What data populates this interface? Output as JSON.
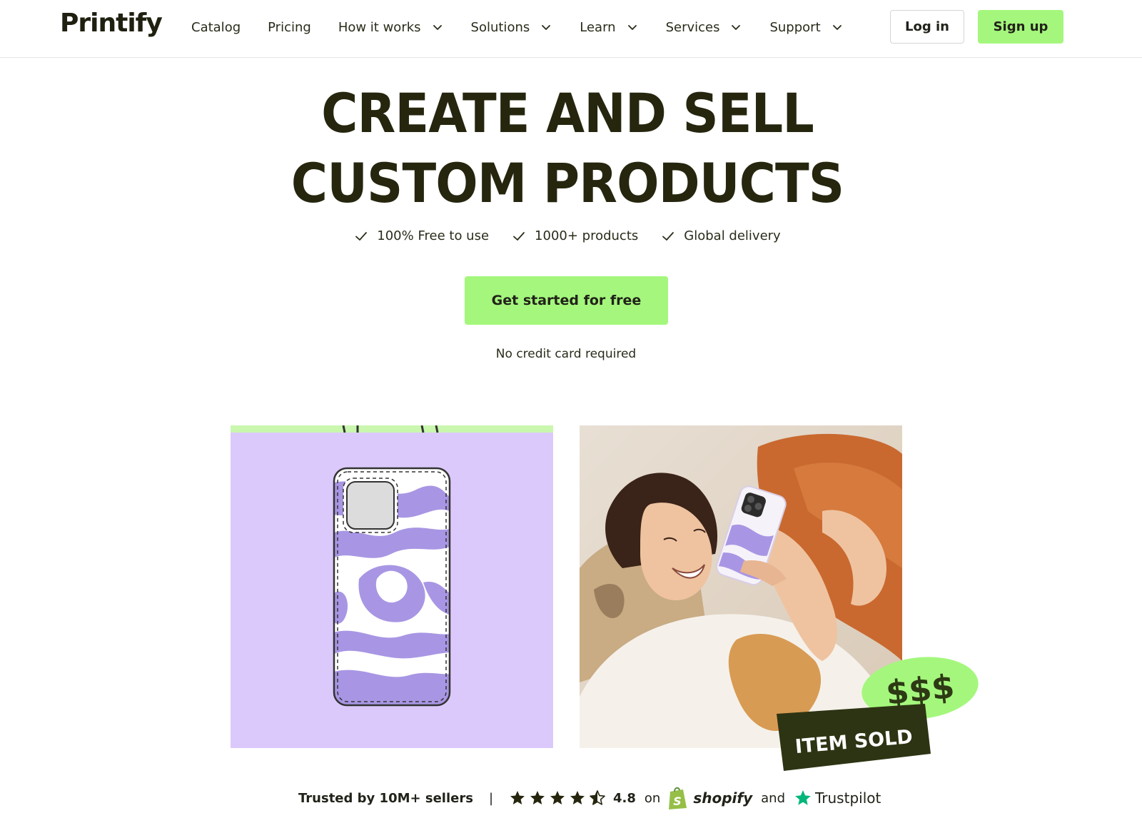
{
  "header": {
    "logo": "Printify",
    "nav": [
      {
        "label": "Catalog",
        "dropdown": false
      },
      {
        "label": "Pricing",
        "dropdown": false
      },
      {
        "label": "How it works",
        "dropdown": true
      },
      {
        "label": "Solutions",
        "dropdown": true
      },
      {
        "label": "Learn",
        "dropdown": true
      },
      {
        "label": "Services",
        "dropdown": true
      },
      {
        "label": "Support",
        "dropdown": true
      }
    ],
    "login_label": "Log in",
    "signup_label": "Sign up"
  },
  "hero": {
    "title_line1": "CREATE AND SELL",
    "title_line2": "CUSTOM PRODUCTS",
    "benefits": [
      "100% Free to use",
      "1000+ products",
      "Global delivery"
    ],
    "cta_label": "Get started for free",
    "note": "No credit card required"
  },
  "badges": {
    "money": "$$$",
    "sold": "ITEM SOLD"
  },
  "trust": {
    "sellers": "Trusted by 10M+ sellers",
    "separator": "|",
    "rating": "4.8",
    "on": "on",
    "shopify": "shopify",
    "and": "and",
    "trustpilot": "Trustpilot",
    "stars": 4.5
  },
  "colors": {
    "accent_green": "#a4f77c",
    "lavender": "#dcc9fb",
    "dark_text": "#26260f",
    "trustpilot_green": "#00b67a",
    "shopify_green": "#95bf47"
  }
}
